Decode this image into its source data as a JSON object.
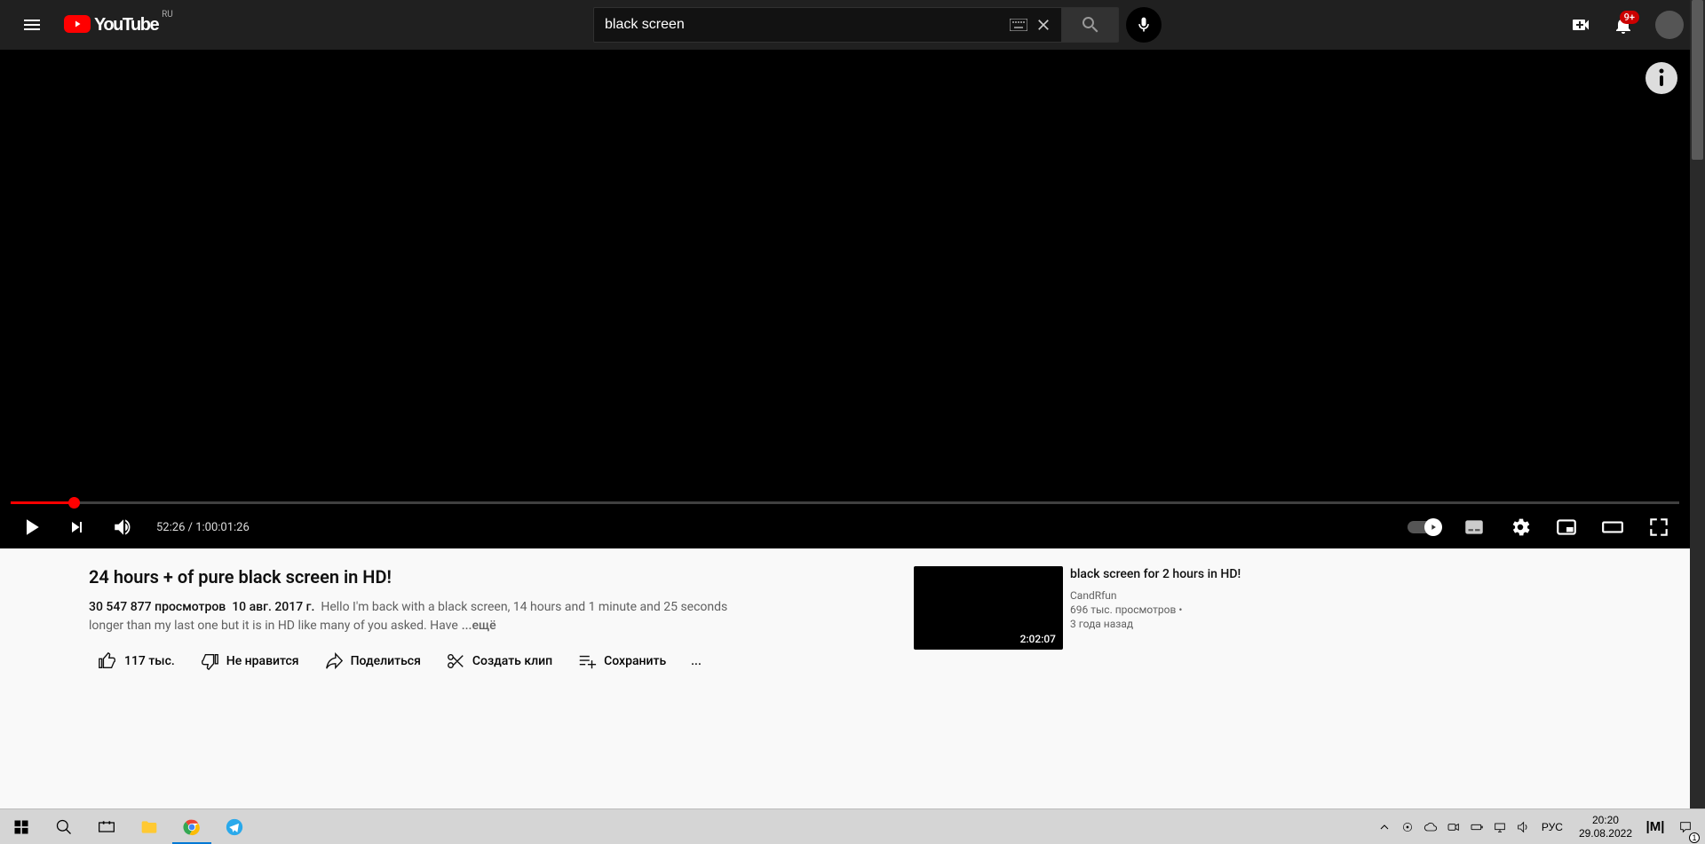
{
  "header": {
    "country_code": "RU",
    "logo_text": "YouTube",
    "search_value": "black screen",
    "notif_badge": "9+"
  },
  "player": {
    "current_time": "52:26",
    "sep": " / ",
    "duration": "1:00:01:26",
    "progress_percent": 3.8
  },
  "video": {
    "title": "24 hours + of pure black screen in HD!",
    "views": "30 547 877 просмотров",
    "date": "10 авг. 2017 г.",
    "description": "Hello I'm back with a black screen, 14 hours and 1 minute and 25 seconds longer than my last one but it is in HD like many of you asked. Have",
    "more": "...ещё"
  },
  "actions": {
    "like": "117 тыс.",
    "dislike": "Не нравится",
    "share": "Поделиться",
    "clip": "Создать клип",
    "save": "Сохранить",
    "more": "..."
  },
  "recommend": {
    "title": "black screen for 2 hours in HD!",
    "channel": "CandRfun",
    "views": "696 тыс. просмотров",
    "age": "3 года назад",
    "duration": "2:02:07",
    "sep": " • "
  },
  "taskbar": {
    "lang": "РУС",
    "time": "20:20",
    "date": "29.08.2022",
    "action_center_count": "1"
  }
}
